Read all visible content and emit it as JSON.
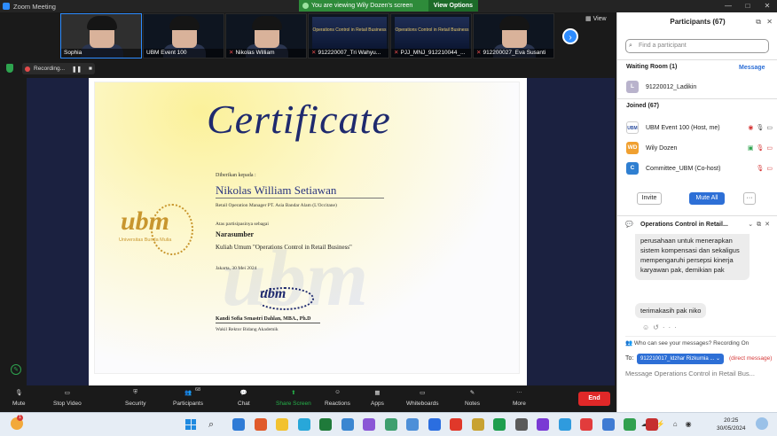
{
  "window": {
    "title": "Zoom Meeting",
    "controls": [
      "—",
      "□",
      "✕"
    ]
  },
  "banner": {
    "text": "You are viewing Wily Dozen's screen",
    "options": "View Options"
  },
  "gallery": {
    "tiles": [
      {
        "name": "Sophia",
        "muted": false,
        "kind": "face"
      },
      {
        "name": "UBM Event 100",
        "muted": false,
        "kind": "face"
      },
      {
        "name": "Nikolas William",
        "muted": true,
        "kind": "face"
      },
      {
        "name": "912220007_Tri Wahyu...",
        "muted": true,
        "kind": "slide"
      },
      {
        "name": "PJJ_MNJ_912210044_...",
        "muted": true,
        "kind": "slide"
      },
      {
        "name": "912200027_Eva Susanti",
        "muted": true,
        "kind": "face"
      }
    ],
    "slide_text": "Operations Control in Retail Business",
    "view_label": "View"
  },
  "recording": {
    "label": "Recording..."
  },
  "certificate": {
    "title": "Certificate",
    "given_to": "Diberikan kepada :",
    "name": "Nikolas William Setiawan",
    "role": "Retail Operation Manager PT. Asia Bandar Alam (L'Occitane)",
    "as_label": "Atas partisipasinya sebagai",
    "as_value": "Narasumber",
    "event": "Kuliah Umum \"Operations Control in Retail Business\"",
    "date": "Jakarta, 30 Mei 2024",
    "signer": "Kandi Sofia Senastri Dahlan, MBA., Ph.D",
    "signer_title": "Wakil Rektor Bidang Akademik",
    "logo": "ubm",
    "logo_sub": "Universitas Bunda Mulia"
  },
  "toolbar": {
    "items": [
      {
        "label": "Mute",
        "icon": "mic-icon"
      },
      {
        "label": "Stop Video",
        "icon": "video-icon"
      },
      {
        "label": "Security",
        "icon": "shield-icon"
      },
      {
        "label": "Participants",
        "icon": "participants-icon",
        "badge": "68"
      },
      {
        "label": "Chat",
        "icon": "chat-icon"
      },
      {
        "label": "Share Screen",
        "icon": "share-icon"
      },
      {
        "label": "Reactions",
        "icon": "reactions-icon"
      },
      {
        "label": "Apps",
        "icon": "apps-icon"
      },
      {
        "label": "Whiteboards",
        "icon": "whiteboard-icon"
      },
      {
        "label": "Notes",
        "icon": "notes-icon"
      },
      {
        "label": "More",
        "icon": "more-icon"
      }
    ],
    "end_label": "End"
  },
  "participants": {
    "title": "Participants (67)",
    "search_placeholder": "Find a participant",
    "waiting_label": "Waiting Room (1)",
    "message_label": "Message",
    "waiting": [
      {
        "initial": "L",
        "name": "91220012_Ladikin",
        "color": "#b9b3cc"
      }
    ],
    "joined_label": "Joined (67)",
    "joined": [
      {
        "initial": "UBM",
        "name": "UBM Event 100 (Host, me)",
        "color": "#ffffff"
      },
      {
        "initial": "WD",
        "name": "Wily Dozen",
        "color": "#f0a030"
      },
      {
        "initial": "C",
        "name": "Committee_UBM (Co-host)",
        "color": "#2f7fd1"
      }
    ],
    "invite_label": "Invite",
    "mute_all_label": "Mute All",
    "more_label": "···"
  },
  "chat": {
    "title": "Operations Control in Retail...",
    "message1": "perusahaan untuk menerapkan sistem kompensasi dan sekaligus mempengaruhi persepsi kinerja karyawan pak, demikian pak",
    "message2": "terimakasih pak niko",
    "who_can_see": "Who can see your messages? Recording On",
    "to_label": "To:",
    "to_value": "912210017_Idzhar Rizkurnia ...",
    "direct_label": "(direct message)",
    "input_placeholder": "Message Operations Control in Retail Bus..."
  },
  "taskbar": {
    "weather_badge": "1",
    "time": "20:25",
    "date": "30/05/2024",
    "apps": [
      "#2f7bd6",
      "#e05a2b",
      "#f2c230",
      "#28a7d9",
      "#1f7a3a",
      "#3a86d1",
      "#8a57d6",
      "#3e9f6f",
      "#4d8fd8",
      "#2b6ee0",
      "#e0382a",
      "#c8a232",
      "#1e9e4e",
      "#5a5a5a",
      "#7a3ad4",
      "#2f9bde",
      "#e23c3c",
      "#3f7bd3",
      "#31a04f",
      "#c62f2f"
    ],
    "tray": [
      "^",
      "☁",
      "⚡",
      "⌂",
      "◉"
    ]
  }
}
